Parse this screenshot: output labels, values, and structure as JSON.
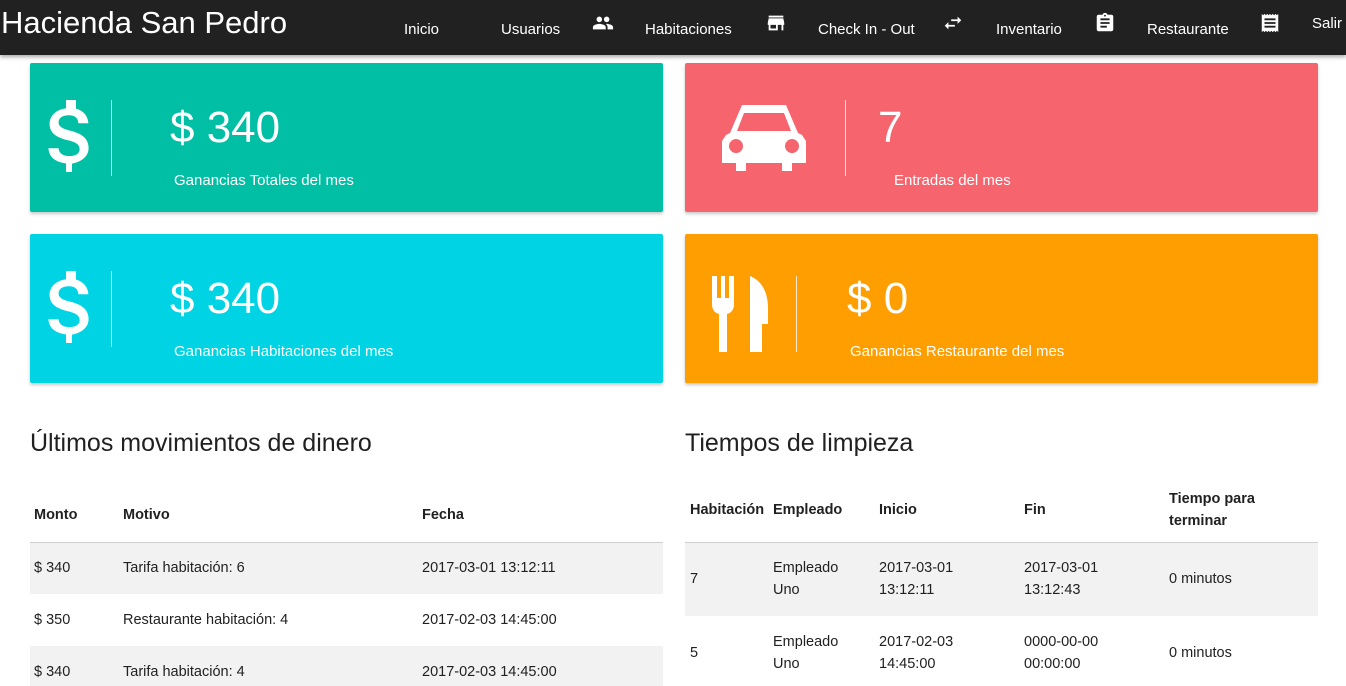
{
  "app": {
    "title": "Hacienda San Pedro"
  },
  "nav": {
    "items": [
      {
        "label": "Inicio"
      },
      {
        "label": "Usuarios",
        "icon": "group-icon"
      },
      {
        "label": "Habitaciones",
        "icon": "store-icon"
      },
      {
        "label": "Check In - Out",
        "icon": "swap-arrows-icon"
      },
      {
        "label": "Inventario",
        "icon": "clipboard-icon"
      },
      {
        "label": "Restaurante",
        "icon": "receipt-icon"
      },
      {
        "label": "Salir"
      }
    ]
  },
  "cards": [
    {
      "value": "$ 340",
      "label": "Ganancias Totales del mes",
      "icon": "dollar-icon",
      "color": "#00bfa5"
    },
    {
      "value": "7",
      "label": "Entradas del mes",
      "icon": "car-icon",
      "color": "#f6646e"
    },
    {
      "value": "$ 340",
      "label": "Ganancias Habitaciones del mes",
      "icon": "dollar-icon",
      "color": "#00d4e4"
    },
    {
      "value": "$ 0",
      "label": "Ganancias Restaurante del mes",
      "icon": "restaurant-icon",
      "color": "#ff9e00"
    }
  ],
  "movements": {
    "title": "Últimos movimientos de dinero",
    "columns": [
      "Monto",
      "Motivo",
      "Fecha"
    ],
    "rows": [
      [
        "$ 340",
        "Tarifa habitación: 6",
        "2017-03-01 13:12:11"
      ],
      [
        "$ 350",
        "Restaurante habitación: 4",
        "2017-02-03 14:45:00"
      ],
      [
        "$ 340",
        "Tarifa habitación: 4",
        "2017-02-03 14:45:00"
      ]
    ]
  },
  "cleaning": {
    "title": "Tiempos de limpieza",
    "columns": [
      "Habitación",
      "Empleado",
      "Inicio",
      "Fin",
      "Tiempo para terminar"
    ],
    "rows": [
      [
        "7",
        "Empleado Uno",
        "2017-03-01 13:12:11",
        "2017-03-01 13:12:43",
        "0 minutos"
      ],
      [
        "5",
        "Empleado Uno",
        "2017-02-03 14:45:00",
        "0000-00-00 00:00:00",
        "0 minutos"
      ]
    ]
  }
}
